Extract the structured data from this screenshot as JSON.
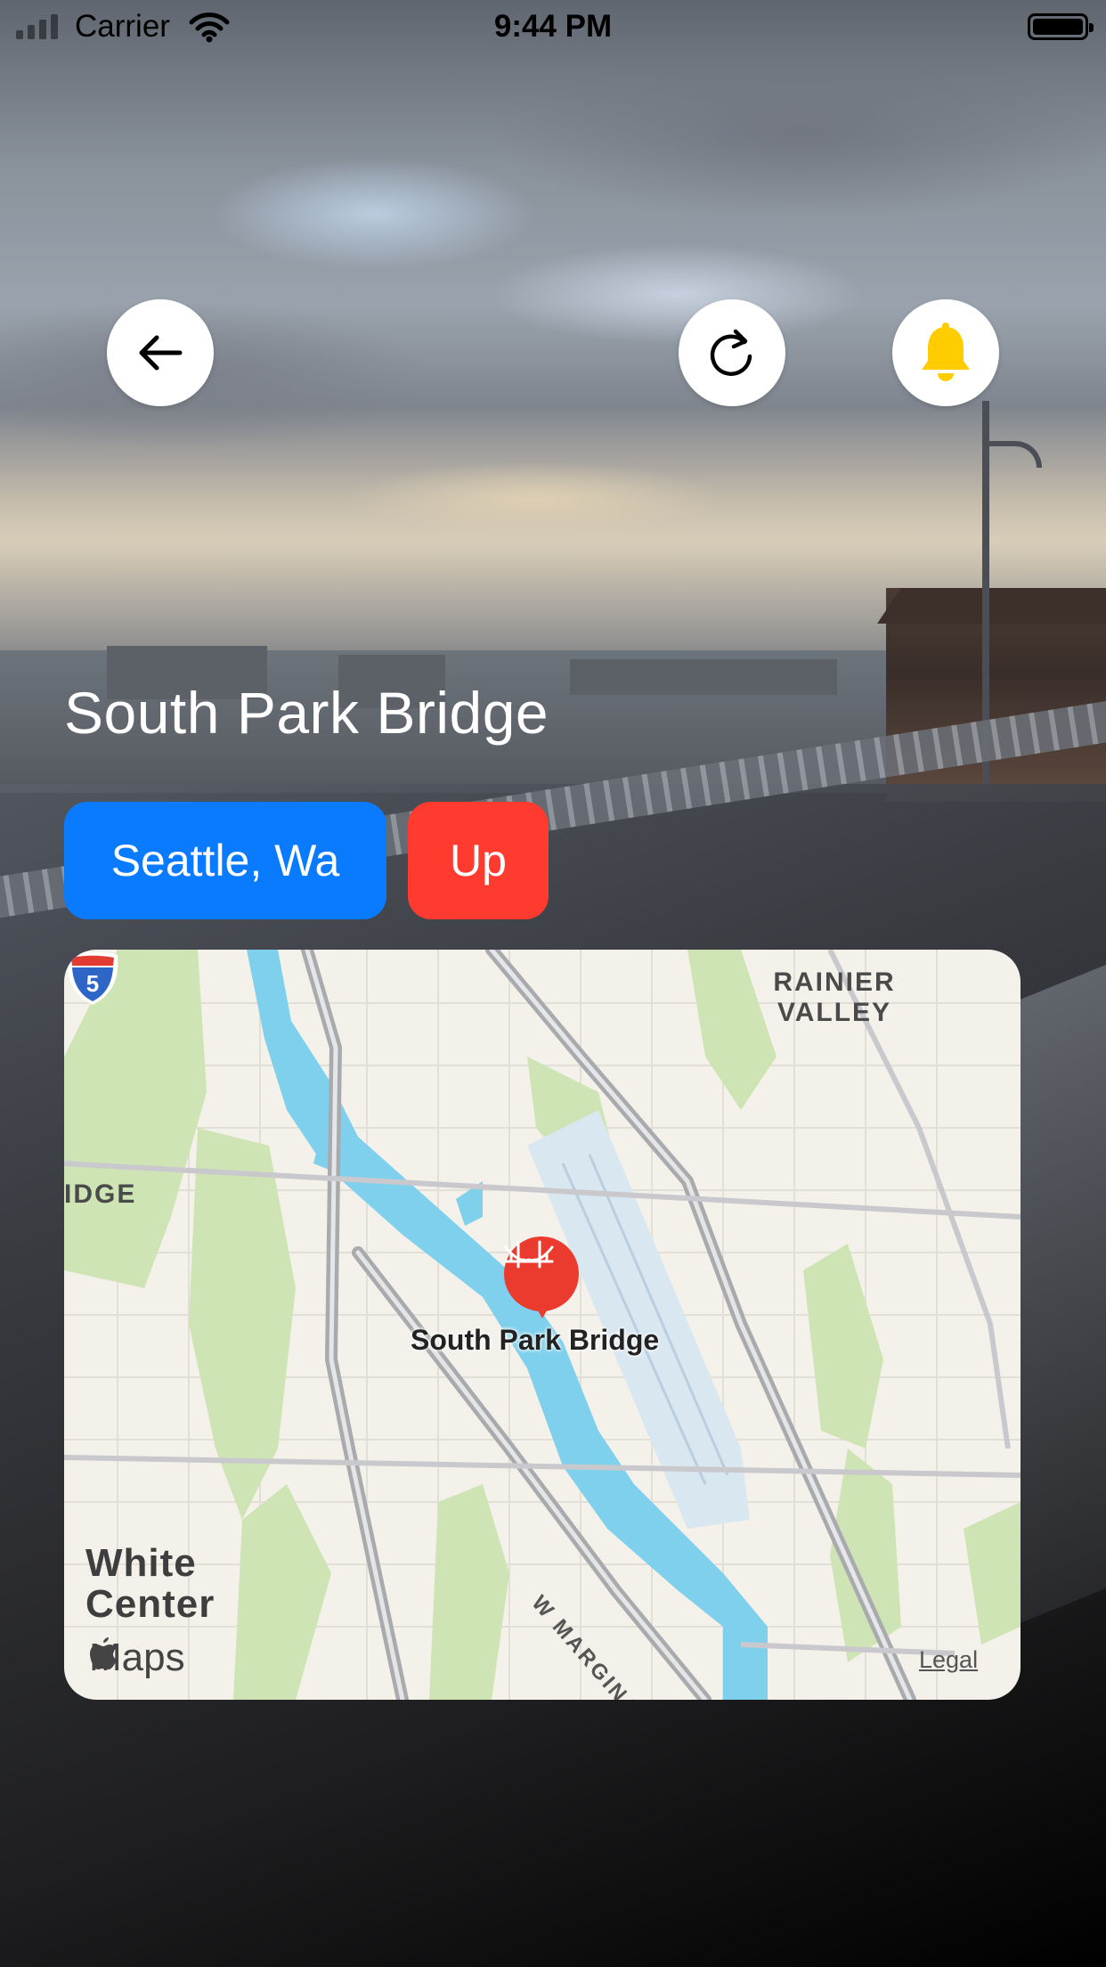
{
  "status_bar": {
    "carrier": "Carrier",
    "time": "9:44 PM"
  },
  "toolbar": {
    "back_icon": "arrow-left-icon",
    "refresh_icon": "refresh-icon",
    "notify_icon": "bell-icon",
    "bell_color": "#ffcc00"
  },
  "bridge": {
    "name": "South Park Bridge",
    "location": "Seattle, Wa",
    "status": "Up",
    "location_color": "#0a7bff",
    "status_color": "#ff3b30"
  },
  "map": {
    "labels": {
      "rainier_valley": "RAINIER VALLEY",
      "ridge": "IDGE",
      "white_center": "White Center",
      "marginal": "W MARGINAL WAY S",
      "interstate": "5"
    },
    "pin_label": "South Park Bridge",
    "pin_icon": "bridge-icon",
    "attribution": "Maps",
    "legal": "Legal"
  }
}
